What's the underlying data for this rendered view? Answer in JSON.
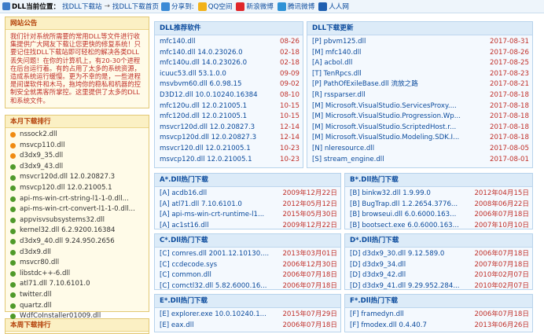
{
  "topbar": {
    "location_label": "DLL当前位置：",
    "crumb_home": "找DLL下载站",
    "crumb_arrow": "→",
    "crumb_page": "找DLL下载首页",
    "share_label": "分享到:",
    "shares": [
      "QQ空间",
      "新浪微博",
      "腾讯微博",
      "人人网"
    ]
  },
  "notice": {
    "title": "网站公告",
    "text": "我们针对系统所需要的常用DLL等文件进行收集提供广大网友下载让您更快的修复系统！只要记住找DLL下载站即可轻松的解决各类DLL丢失问题！在你的计算机上，有20-30个进程在后台运行着。有的占用了太多的系统资源，造成系统运行缓慢。更为不幸的是，一些进程是间谍软件和木马，拖垮你的稳私和机器的控制安全就黑客所掌控。这里提供了太多的DLL和系统文件。"
  },
  "rank": {
    "title": "本月下载排行",
    "items": [
      {
        "name": "nssock2.dll",
        "color": "o"
      },
      {
        "name": "msvcp110.dll",
        "color": "o"
      },
      {
        "name": "d3dx9_35.dll",
        "color": "o"
      },
      {
        "name": "d3dx9_43.dll",
        "color": "g"
      },
      {
        "name": "msvcr120d.dll 12.0.20827.3",
        "color": "g"
      },
      {
        "name": "msvcp120.dll 12.0.21005.1",
        "color": "g"
      },
      {
        "name": "api-ms-win-crt-string-l1-1-0.dll...",
        "color": "g"
      },
      {
        "name": "api-ms-win-crt-convert-l1-1-0.dll...",
        "color": "g"
      },
      {
        "name": "appvisvsubsystems32.dll",
        "color": "g"
      },
      {
        "name": "kernel32.dll 6.2.9200.16384",
        "color": "g"
      },
      {
        "name": "d3dx9_40.dll 9.24.950.2656",
        "color": "g"
      },
      {
        "name": "d3dx9.dll",
        "color": "g"
      },
      {
        "name": "msvcr80.dll",
        "color": "g"
      },
      {
        "name": "libstdc++-6.dll",
        "color": "g"
      },
      {
        "name": "atl71.dll 7.10.6101.0",
        "color": "g"
      },
      {
        "name": "twitter.dll",
        "color": "g"
      },
      {
        "name": "quartz.dll",
        "color": "g"
      },
      {
        "name": "WdfCoInstaller01009.dll",
        "color": "g"
      }
    ]
  },
  "rank2": {
    "title": "本周下载排行"
  },
  "recommend": {
    "title": "DLL推荐软件",
    "rows": [
      {
        "name": "mfc140.dll",
        "date": "08-26"
      },
      {
        "name": "mfc140.dll 14.0.23026.0",
        "date": "02-18"
      },
      {
        "name": "mfc140u.dll 14.0.23026.0",
        "date": "02-18"
      },
      {
        "name": "icuuc53.dll 53.1.0.0",
        "date": "09-09"
      },
      {
        "name": "msvbvm60.dll 6.0.98.15",
        "date": "09-02"
      },
      {
        "name": "D3D12.dll 10.0.10240.16384",
        "date": "08-10"
      },
      {
        "name": "mfc120u.dll 12.0.21005.1",
        "date": "10-15"
      },
      {
        "name": "mfc120d.dll 12.0.21005.1",
        "date": "10-15"
      },
      {
        "name": "msvcr120d.dll 12.0.20827.3",
        "date": "12-14"
      },
      {
        "name": "msvcp120d.dll 12.0.20827.3",
        "date": "12-14"
      },
      {
        "name": "msvcr120.dll 12.0.21005.1",
        "date": "10-23"
      },
      {
        "name": "msvcp120.dll 12.0.21005.1",
        "date": "10-23"
      }
    ]
  },
  "updates": {
    "title": "DLL下载更新",
    "rows": [
      {
        "name": "[P] pbvm125.dll",
        "date": "2017-08-31"
      },
      {
        "name": "[M] mfc140.dll",
        "date": "2017-08-26"
      },
      {
        "name": "[A] acbol.dll",
        "date": "2017-08-25"
      },
      {
        "name": "[T] TenRpcs.dll",
        "date": "2017-08-23"
      },
      {
        "name": "[P] PathOfExileBase.dll 流放之路",
        "date": "2017-08-21"
      },
      {
        "name": "[R] rssparser.dll",
        "date": "2017-08-18"
      },
      {
        "name": "[M] Microsoft.VisualStudio.ServicesProxy....",
        "date": "2017-08-18"
      },
      {
        "name": "[M] Microsoft.VisualStudio.Progression.Wp...",
        "date": "2017-08-18"
      },
      {
        "name": "[M] Microsoft.VisualStudio.ScriptedHost.r...",
        "date": "2017-08-18"
      },
      {
        "name": "[M] Microsoft.VisualStudio.Modeling.SDK.I...",
        "date": "2017-08-18"
      },
      {
        "name": "[N] nleresource.dll",
        "date": "2017-08-05"
      },
      {
        "name": "[S] stream_engine.dll",
        "date": "2017-08-01"
      }
    ]
  },
  "hotA": {
    "title": "A*.Dll热门下载",
    "rows": [
      {
        "name": "[A] acdb16.dll",
        "date": "2009年12月22日"
      },
      {
        "name": "[A] atl71.dll 7.10.6101.0",
        "date": "2012年05月12日"
      },
      {
        "name": "[A] api-ms-win-crt-runtime-l1...",
        "date": "2015年05月30日"
      },
      {
        "name": "[A] ac1st16.dll",
        "date": "2009年12月22日"
      }
    ]
  },
  "hotB": {
    "title": "B*.Dll热门下载",
    "rows": [
      {
        "name": "[B] binkw32.dll 1.9.99.0",
        "date": "2012年04月15日"
      },
      {
        "name": "[B] BugTrap.dll 1.2.2654.3776...",
        "date": "2008年06月22日"
      },
      {
        "name": "[B] browseui.dll 6.0.6000.163...",
        "date": "2006年07月18日"
      },
      {
        "name": "[B] bootsect.exe 6.0.6000.163...",
        "date": "2007年10月10日"
      }
    ]
  },
  "hotC": {
    "title": "C*.Dll热门下载",
    "rows": [
      {
        "name": "[C] comres.dll 2001.12.10130....",
        "date": "2013年03月01日"
      },
      {
        "name": "[C] ccdecode.sys",
        "date": "2006年12月30日"
      },
      {
        "name": "[C] common.dll",
        "date": "2006年07月18日"
      },
      {
        "name": "[C] comctl32.dll 5.82.6000.16...",
        "date": "2006年07月18日"
      }
    ]
  },
  "hotD": {
    "title": "D*.Dll热门下载",
    "rows": [
      {
        "name": "[D] d3dx9_30.dll 9.12.589.0",
        "date": "2006年07月18日"
      },
      {
        "name": "[D] d3dx9_34.dll",
        "date": "2007年07月18日"
      },
      {
        "name": "[D] d3dx9_42.dll",
        "date": "2010年02月07日"
      },
      {
        "name": "[D] d3dx9_41.dll 9.29.952.284...",
        "date": "2010年02月07日"
      }
    ]
  },
  "hotE": {
    "title": "E*.Dll热门下载",
    "rows": [
      {
        "name": "[E] explorer.exe 10.0.10240.1...",
        "date": "2015年07月29日"
      },
      {
        "name": "[E] eax.dll",
        "date": "2006年07月18日"
      }
    ]
  },
  "hotF": {
    "title": "F*.Dll热门下载",
    "rows": [
      {
        "name": "[F] framedyn.dll",
        "date": "2006年07月18日"
      },
      {
        "name": "[F] fmodex.dll 0.4.40.7",
        "date": "2013年06月26日"
      }
    ]
  },
  "colors": {
    "link": "#0a4a9c",
    "date": "#c0302a",
    "panel_border": "#b7d3ec",
    "notice_text": "#c0302a"
  }
}
